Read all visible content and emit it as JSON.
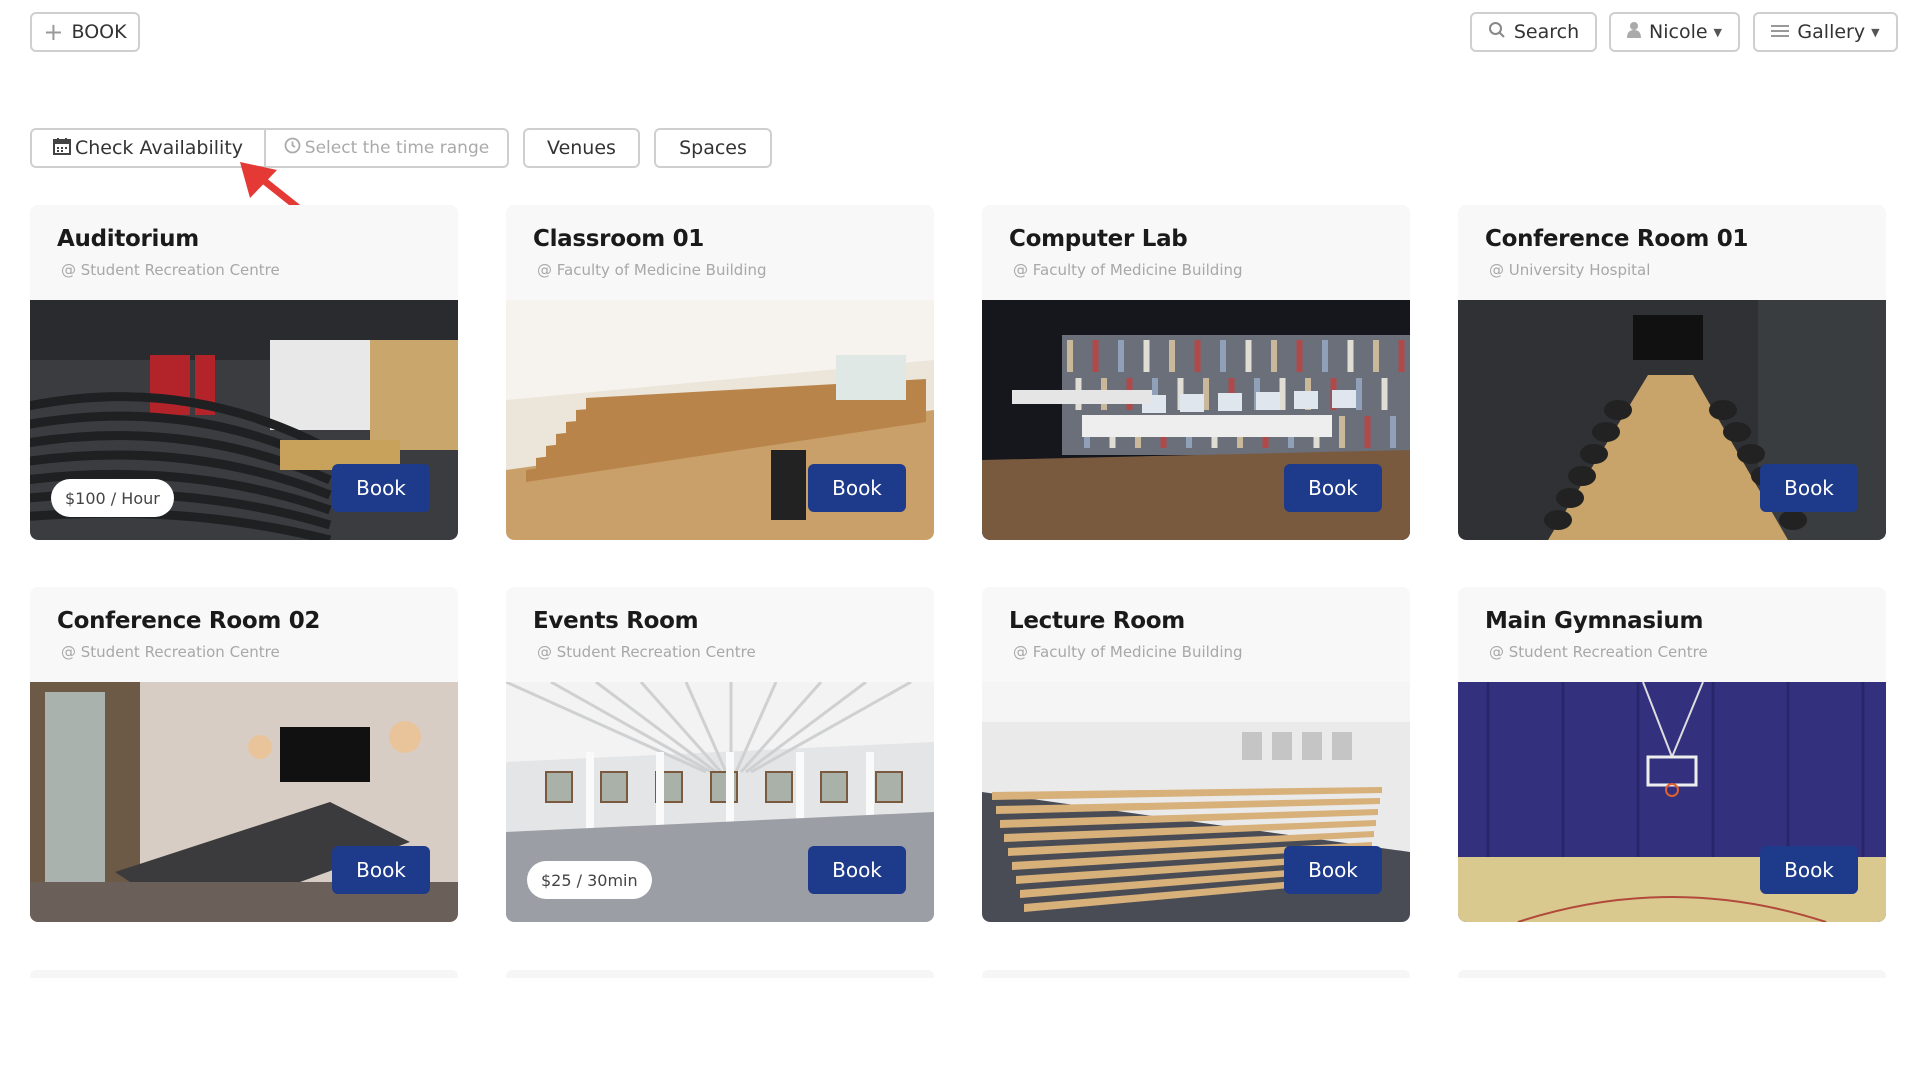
{
  "header": {
    "book_label": "BOOK",
    "search_label": "Search",
    "user_label": "Nicole",
    "view_label": "Gallery"
  },
  "filters": {
    "check_availability_label": "Check Availability",
    "time_range_placeholder": "Select the time range",
    "venues_label": "Venues",
    "spaces_label": "Spaces"
  },
  "cards": [
    {
      "title": "Auditorium",
      "location": "@ Student Recreation Centre",
      "price": "$100 / Hour",
      "book_label": "Book",
      "image": "auditorium-photo"
    },
    {
      "title": "Classroom 01",
      "location": "@ Faculty of Medicine Building",
      "book_label": "Book",
      "image": "classroom-photo"
    },
    {
      "title": "Computer Lab",
      "location": "@ Faculty of Medicine Building",
      "book_label": "Book",
      "image": "computer-lab-photo"
    },
    {
      "title": "Conference Room 01",
      "location": "@ University Hospital",
      "book_label": "Book",
      "image": "conference-room-photo"
    },
    {
      "title": "Conference Room 02",
      "location": "@ Student Recreation Centre",
      "book_label": "Book",
      "image": "meeting-room-photo"
    },
    {
      "title": "Events Room",
      "location": "@ Student Recreation Centre",
      "price": "$25 / 30min",
      "book_label": "Book",
      "image": "events-room-photo"
    },
    {
      "title": "Lecture Room",
      "location": "@ Faculty of Medicine Building",
      "book_label": "Book",
      "image": "lecture-room-photo"
    },
    {
      "title": "Main Gymnasium",
      "location": "@ Student Recreation Centre",
      "book_label": "Book",
      "image": "gymnasium-photo"
    }
  ],
  "colors": {
    "primary": "#1e3a8a",
    "annotation": "#e53935",
    "border": "#cfcfcf",
    "card_bg": "#f8f8f8"
  }
}
